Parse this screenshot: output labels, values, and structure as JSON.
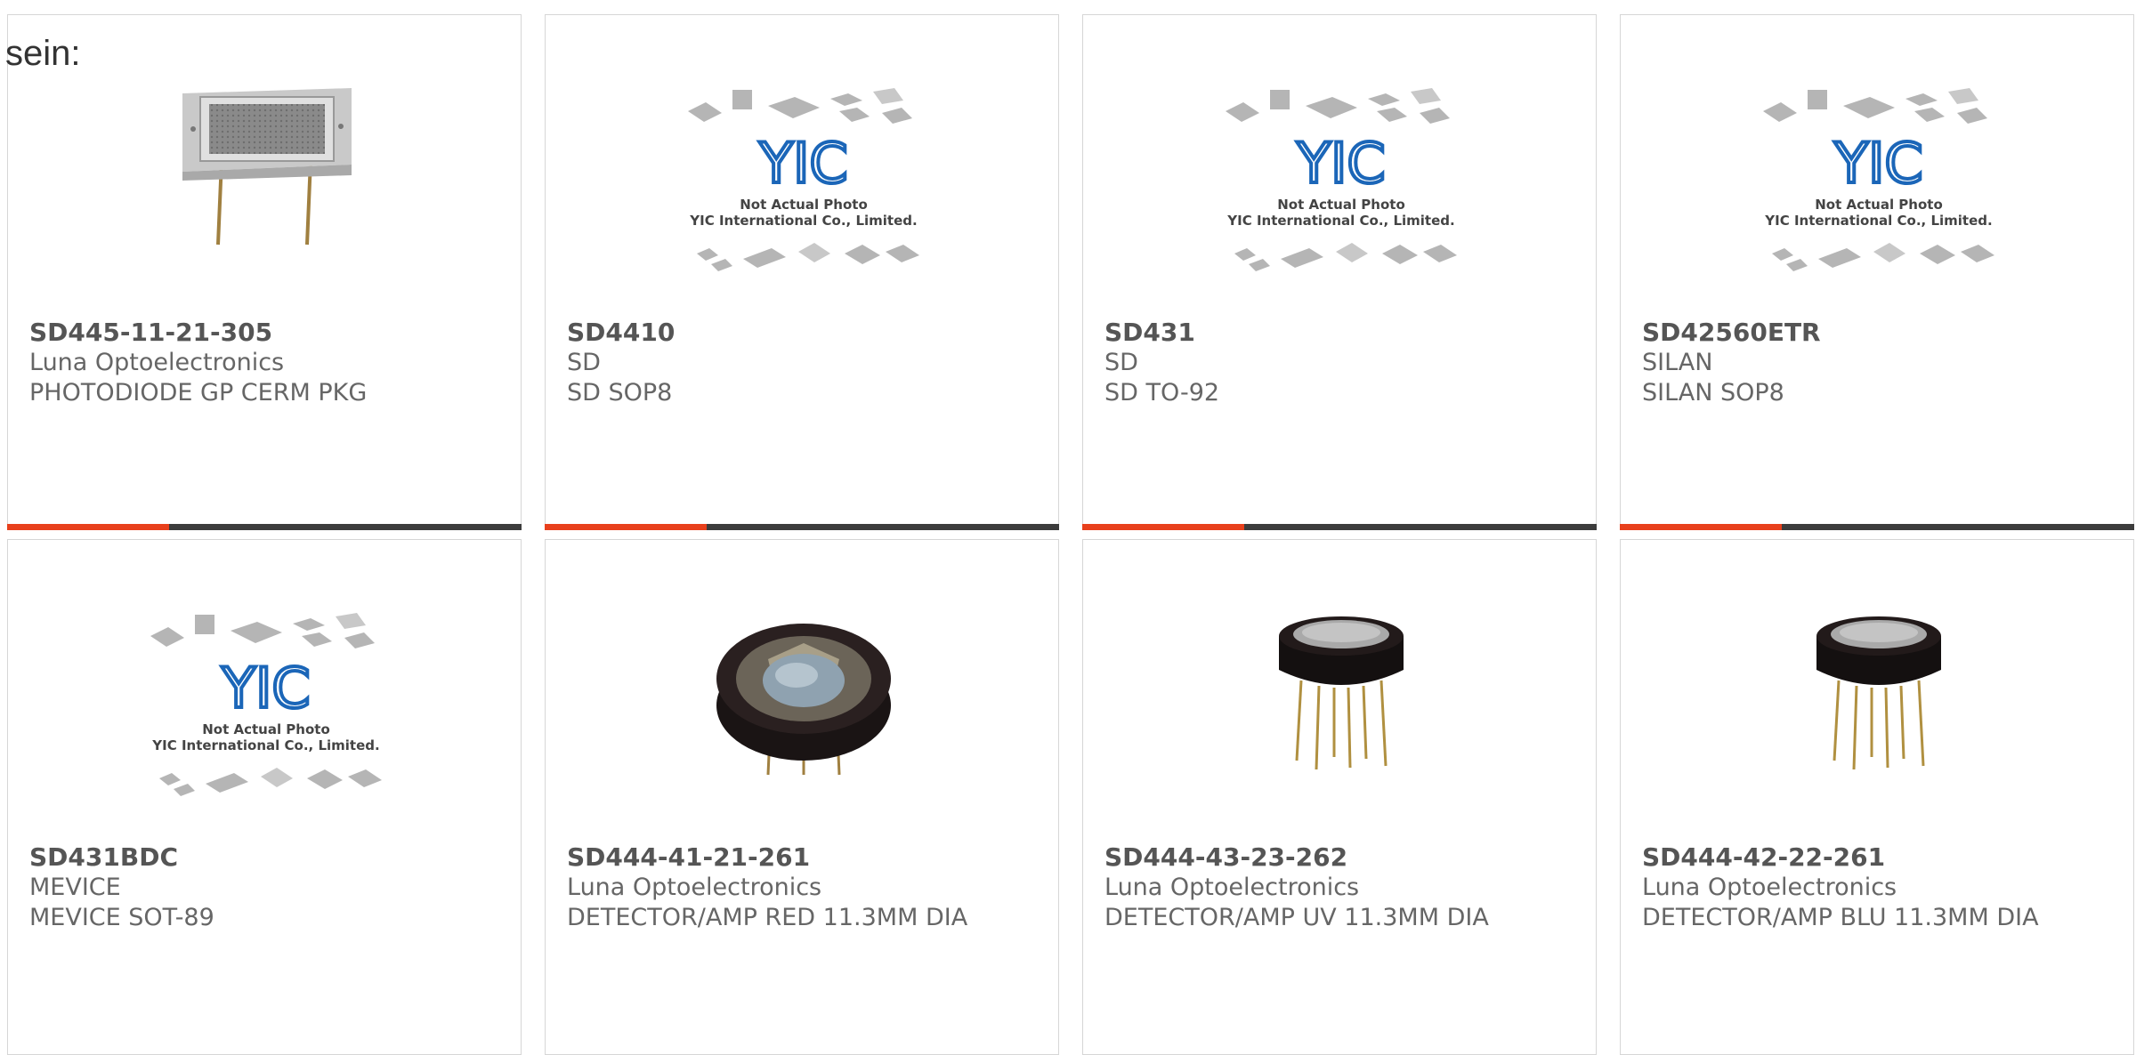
{
  "page": {
    "lead_text": "sein:"
  },
  "colors": {
    "accent": "#e8401c",
    "bar": "#3c3c3c",
    "border": "#d6d6d6"
  },
  "placeholder": {
    "logo": "YIC",
    "line1": "Not Actual Photo",
    "line2": "YIC International Co., Limited."
  },
  "products": [
    {
      "part_number": "SD445-11-21-305",
      "manufacturer": "Luna Optoelectronics",
      "description": "PHOTODIODE GP CERM PKG",
      "image": "photodiode-ceramic",
      "has_bar": true
    },
    {
      "part_number": "SD4410",
      "manufacturer": "SD",
      "description": "SD SOP8",
      "image": "yic-placeholder",
      "has_bar": true
    },
    {
      "part_number": "SD431",
      "manufacturer": "SD",
      "description": "SD TO-92",
      "image": "yic-placeholder",
      "has_bar": true
    },
    {
      "part_number": "SD42560ETR",
      "manufacturer": "SILAN",
      "description": "SILAN SOP8",
      "image": "yic-placeholder",
      "has_bar": true
    },
    {
      "part_number": "SD431BDC",
      "manufacturer": "MEVICE",
      "description": "MEVICE SOT-89",
      "image": "yic-placeholder",
      "has_bar": false
    },
    {
      "part_number": "SD444-41-21-261",
      "manufacturer": "Luna Optoelectronics",
      "description": "DETECTOR/AMP RED 11.3MM DIA",
      "image": "detector-to-can-window",
      "has_bar": false
    },
    {
      "part_number": "SD444-43-23-262",
      "manufacturer": "Luna Optoelectronics",
      "description": "DETECTOR/AMP UV 11.3MM DIA",
      "image": "detector-to-can-pins",
      "has_bar": false
    },
    {
      "part_number": "SD444-42-22-261",
      "manufacturer": "Luna Optoelectronics",
      "description": "DETECTOR/AMP BLU 11.3MM DIA",
      "image": "detector-to-can-pins",
      "has_bar": false
    }
  ]
}
